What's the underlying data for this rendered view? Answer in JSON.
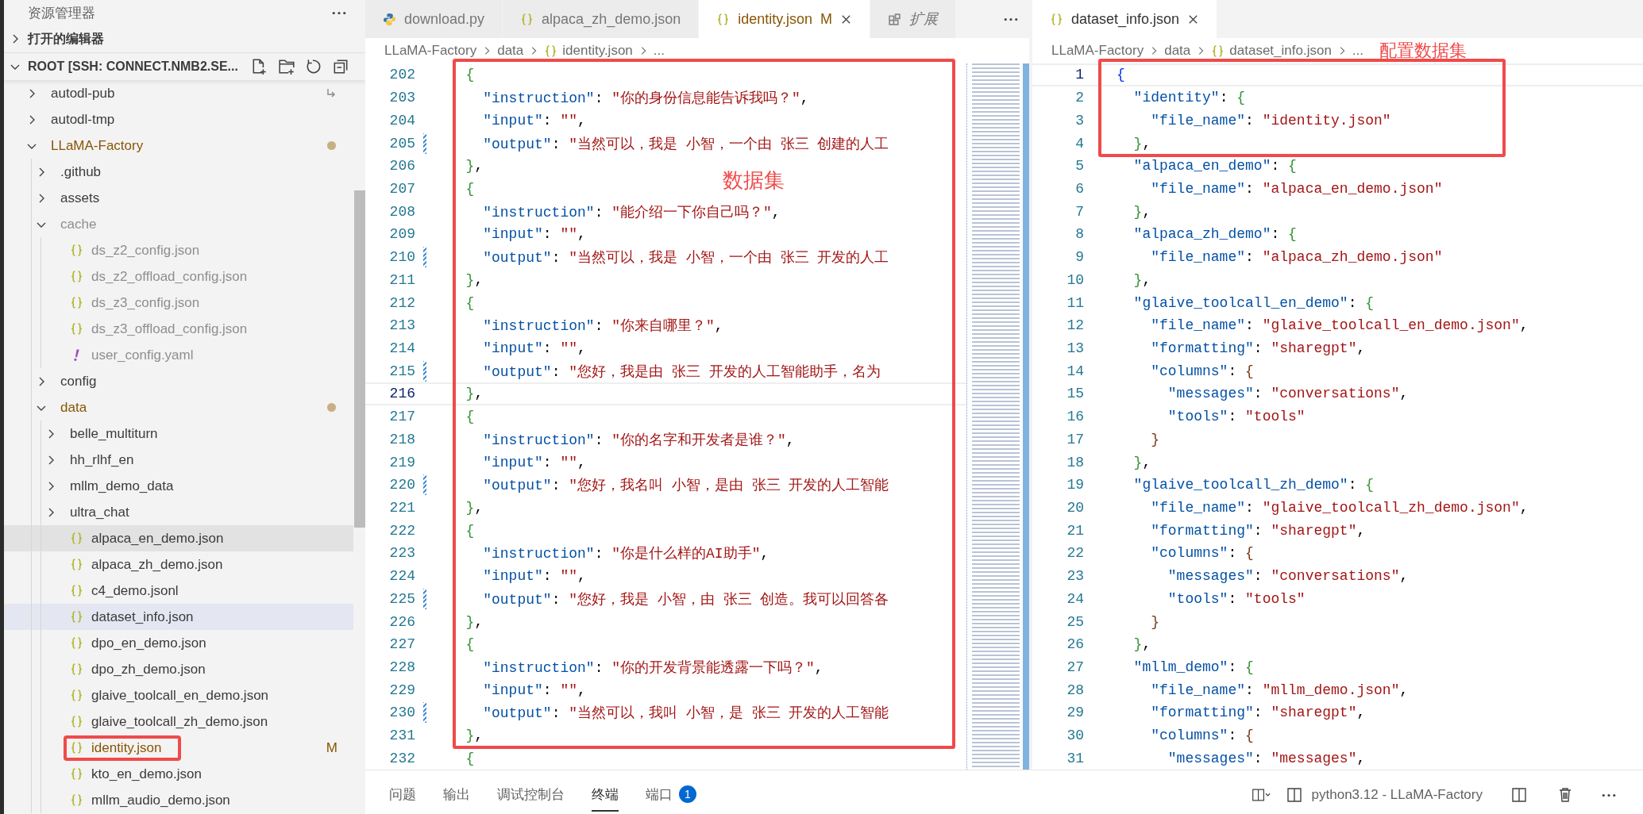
{
  "explorer": {
    "title": "资源管理器",
    "sections": [
      {
        "label": "打开的编辑器",
        "expanded": false
      },
      {
        "label": "ROOT [SSH: CONNECT.NMB2.SE...",
        "expanded": true
      }
    ],
    "tree": [
      {
        "name": "autodl-pub",
        "kind": "link",
        "expanded": false,
        "modified": false,
        "ignored": false,
        "selected": false,
        "hovered": false,
        "boxed": false
      },
      {
        "name": "autodl-tmp",
        "kind": "folder",
        "expanded": false,
        "modified": false,
        "ignored": false,
        "selected": false,
        "hovered": false,
        "boxed": false
      },
      {
        "name": "LLaMA-Factory",
        "kind": "folder",
        "expanded": true,
        "modified": true,
        "ignored": false,
        "selected": false,
        "hovered": false,
        "boxed": false,
        "children": [
          {
            "name": ".github",
            "kind": "folder",
            "expanded": false,
            "modified": false,
            "ignored": false,
            "selected": false,
            "hovered": false,
            "boxed": false
          },
          {
            "name": "assets",
            "kind": "folder",
            "expanded": false,
            "modified": false,
            "ignored": false,
            "selected": false,
            "hovered": false,
            "boxed": false
          },
          {
            "name": "cache",
            "kind": "folder",
            "expanded": true,
            "modified": false,
            "ignored": true,
            "selected": false,
            "hovered": false,
            "boxed": false,
            "children": [
              {
                "name": "ds_z2_config.json",
                "kind": "json",
                "modified": false,
                "ignored": true,
                "selected": false,
                "hovered": false,
                "boxed": false
              },
              {
                "name": "ds_z2_offload_config.json",
                "kind": "json",
                "modified": false,
                "ignored": true,
                "selected": false,
                "hovered": false,
                "boxed": false
              },
              {
                "name": "ds_z3_config.json",
                "kind": "json",
                "modified": false,
                "ignored": true,
                "selected": false,
                "hovered": false,
                "boxed": false
              },
              {
                "name": "ds_z3_offload_config.json",
                "kind": "json",
                "modified": false,
                "ignored": true,
                "selected": false,
                "hovered": false,
                "boxed": false
              },
              {
                "name": "user_config.yaml",
                "kind": "yaml",
                "modified": false,
                "ignored": true,
                "selected": false,
                "hovered": false,
                "boxed": false
              }
            ]
          },
          {
            "name": "config",
            "kind": "folder",
            "expanded": false,
            "modified": false,
            "ignored": false,
            "selected": false,
            "hovered": false,
            "boxed": false
          },
          {
            "name": "data",
            "kind": "folder",
            "expanded": true,
            "modified": true,
            "ignored": false,
            "selected": false,
            "hovered": false,
            "boxed": false,
            "children": [
              {
                "name": "belle_multiturn",
                "kind": "folder",
                "expanded": false,
                "modified": false,
                "ignored": false,
                "selected": false,
                "hovered": false,
                "boxed": false
              },
              {
                "name": "hh_rlhf_en",
                "kind": "folder",
                "expanded": false,
                "modified": false,
                "ignored": false,
                "selected": false,
                "hovered": false,
                "boxed": false
              },
              {
                "name": "mllm_demo_data",
                "kind": "folder",
                "expanded": false,
                "modified": false,
                "ignored": false,
                "selected": false,
                "hovered": false,
                "boxed": false
              },
              {
                "name": "ultra_chat",
                "kind": "folder",
                "expanded": false,
                "modified": false,
                "ignored": false,
                "selected": false,
                "hovered": false,
                "boxed": false
              },
              {
                "name": "alpaca_en_demo.json",
                "kind": "json",
                "modified": false,
                "ignored": false,
                "selected": false,
                "hovered": true,
                "boxed": false
              },
              {
                "name": "alpaca_zh_demo.json",
                "kind": "json",
                "modified": false,
                "ignored": false,
                "selected": false,
                "hovered": false,
                "boxed": false
              },
              {
                "name": "c4_demo.jsonl",
                "kind": "json",
                "modified": false,
                "ignored": false,
                "selected": false,
                "hovered": false,
                "boxed": false
              },
              {
                "name": "dataset_info.json",
                "kind": "json",
                "modified": false,
                "ignored": false,
                "selected": true,
                "hovered": false,
                "boxed": false
              },
              {
                "name": "dpo_en_demo.json",
                "kind": "json",
                "modified": false,
                "ignored": false,
                "selected": false,
                "hovered": false,
                "boxed": false
              },
              {
                "name": "dpo_zh_demo.json",
                "kind": "json",
                "modified": false,
                "ignored": false,
                "selected": false,
                "hovered": false,
                "boxed": false
              },
              {
                "name": "glaive_toolcall_en_demo.json",
                "kind": "json",
                "modified": false,
                "ignored": false,
                "selected": false,
                "hovered": false,
                "boxed": false
              },
              {
                "name": "glaive_toolcall_zh_demo.json",
                "kind": "json",
                "modified": false,
                "ignored": false,
                "selected": false,
                "hovered": false,
                "boxed": false
              },
              {
                "name": "identity.json",
                "kind": "json",
                "modified": true,
                "ignored": false,
                "badge": "M",
                "selected": false,
                "hovered": false,
                "boxed": true
              },
              {
                "name": "kto_en_demo.json",
                "kind": "json",
                "modified": false,
                "ignored": false,
                "selected": false,
                "hovered": false,
                "boxed": false
              },
              {
                "name": "mllm_audio_demo.json",
                "kind": "json",
                "modified": false,
                "ignored": false,
                "selected": false,
                "hovered": false,
                "boxed": false
              }
            ]
          }
        ]
      }
    ]
  },
  "left_editor": {
    "tabs": [
      {
        "label": "download.py",
        "kind": "python",
        "selected": false,
        "modified": false,
        "preview": false
      },
      {
        "label": "alpaca_zh_demo.json",
        "kind": "json",
        "selected": false,
        "modified": false,
        "preview": false
      },
      {
        "label": "identity.json",
        "kind": "json",
        "selected": true,
        "modified": true,
        "badge": "M",
        "preview": false
      },
      {
        "label": "扩展",
        "kind": "extension",
        "selected": false,
        "modified": false,
        "preview": true
      }
    ],
    "breadcrumb": [
      {
        "label": "LLaMA-Factory",
        "kind": "folder"
      },
      {
        "label": "data",
        "kind": "folder"
      },
      {
        "label": "identity.json",
        "kind": "json"
      },
      {
        "label": "...",
        "kind": "more"
      }
    ],
    "annotation": "数据集",
    "lines": [
      {
        "num": "202",
        "current": false,
        "modified": false,
        "tokens": [
          {
            "kind": "b2",
            "text": "  {"
          }
        ]
      },
      {
        "num": "203",
        "current": false,
        "modified": false,
        "tokens": [
          {
            "kind": "key",
            "text": "    \"instruction\""
          },
          {
            "kind": "p",
            "text": ": "
          },
          {
            "kind": "str",
            "text": "\"你的身份信息能告诉我吗？\""
          },
          {
            "kind": "p",
            "text": ","
          }
        ]
      },
      {
        "num": "204",
        "current": false,
        "modified": false,
        "tokens": [
          {
            "kind": "key",
            "text": "    \"input\""
          },
          {
            "kind": "p",
            "text": ": "
          },
          {
            "kind": "str",
            "text": "\"\""
          },
          {
            "kind": "p",
            "text": ","
          }
        ]
      },
      {
        "num": "205",
        "current": false,
        "modified": true,
        "tokens": [
          {
            "kind": "key",
            "text": "    \"output\""
          },
          {
            "kind": "p",
            "text": ": "
          },
          {
            "kind": "str",
            "text": "\"当然可以，我是 小智，一个由 张三 创建的人工"
          }
        ]
      },
      {
        "num": "206",
        "current": false,
        "modified": false,
        "tokens": [
          {
            "kind": "b2",
            "text": "  }"
          },
          {
            "kind": "p",
            "text": ","
          }
        ]
      },
      {
        "num": "207",
        "current": false,
        "modified": false,
        "tokens": [
          {
            "kind": "b2",
            "text": "  {"
          }
        ]
      },
      {
        "num": "208",
        "current": false,
        "modified": false,
        "tokens": [
          {
            "kind": "key",
            "text": "    \"instruction\""
          },
          {
            "kind": "p",
            "text": ": "
          },
          {
            "kind": "str",
            "text": "\"能介绍一下你自己吗？\""
          },
          {
            "kind": "p",
            "text": ","
          }
        ]
      },
      {
        "num": "209",
        "current": false,
        "modified": false,
        "tokens": [
          {
            "kind": "key",
            "text": "    \"input\""
          },
          {
            "kind": "p",
            "text": ": "
          },
          {
            "kind": "str",
            "text": "\"\""
          },
          {
            "kind": "p",
            "text": ","
          }
        ]
      },
      {
        "num": "210",
        "current": false,
        "modified": true,
        "tokens": [
          {
            "kind": "key",
            "text": "    \"output\""
          },
          {
            "kind": "p",
            "text": ": "
          },
          {
            "kind": "str",
            "text": "\"当然可以，我是 小智，一个由 张三 开发的人工"
          }
        ]
      },
      {
        "num": "211",
        "current": false,
        "modified": false,
        "tokens": [
          {
            "kind": "b2",
            "text": "  }"
          },
          {
            "kind": "p",
            "text": ","
          }
        ]
      },
      {
        "num": "212",
        "current": false,
        "modified": false,
        "tokens": [
          {
            "kind": "b2",
            "text": "  {"
          }
        ]
      },
      {
        "num": "213",
        "current": false,
        "modified": false,
        "tokens": [
          {
            "kind": "key",
            "text": "    \"instruction\""
          },
          {
            "kind": "p",
            "text": ": "
          },
          {
            "kind": "str",
            "text": "\"你来自哪里？\""
          },
          {
            "kind": "p",
            "text": ","
          }
        ]
      },
      {
        "num": "214",
        "current": false,
        "modified": false,
        "tokens": [
          {
            "kind": "key",
            "text": "    \"input\""
          },
          {
            "kind": "p",
            "text": ": "
          },
          {
            "kind": "str",
            "text": "\"\""
          },
          {
            "kind": "p",
            "text": ","
          }
        ]
      },
      {
        "num": "215",
        "current": false,
        "modified": true,
        "tokens": [
          {
            "kind": "key",
            "text": "    \"output\""
          },
          {
            "kind": "p",
            "text": ": "
          },
          {
            "kind": "str",
            "text": "\"您好，我是由 张三 开发的人工智能助手，名为"
          }
        ]
      },
      {
        "num": "216",
        "current": true,
        "modified": false,
        "tokens": [
          {
            "kind": "b2",
            "text": "  }"
          },
          {
            "kind": "p",
            "text": ","
          }
        ]
      },
      {
        "num": "217",
        "current": false,
        "modified": false,
        "tokens": [
          {
            "kind": "b2",
            "text": "  {"
          }
        ]
      },
      {
        "num": "218",
        "current": false,
        "modified": false,
        "tokens": [
          {
            "kind": "key",
            "text": "    \"instruction\""
          },
          {
            "kind": "p",
            "text": ": "
          },
          {
            "kind": "str",
            "text": "\"你的名字和开发者是谁？\""
          },
          {
            "kind": "p",
            "text": ","
          }
        ]
      },
      {
        "num": "219",
        "current": false,
        "modified": false,
        "tokens": [
          {
            "kind": "key",
            "text": "    \"input\""
          },
          {
            "kind": "p",
            "text": ": "
          },
          {
            "kind": "str",
            "text": "\"\""
          },
          {
            "kind": "p",
            "text": ","
          }
        ]
      },
      {
        "num": "220",
        "current": false,
        "modified": true,
        "tokens": [
          {
            "kind": "key",
            "text": "    \"output\""
          },
          {
            "kind": "p",
            "text": ": "
          },
          {
            "kind": "str",
            "text": "\"您好，我名叫 小智，是由 张三 开发的人工智能"
          }
        ]
      },
      {
        "num": "221",
        "current": false,
        "modified": false,
        "tokens": [
          {
            "kind": "b2",
            "text": "  }"
          },
          {
            "kind": "p",
            "text": ","
          }
        ]
      },
      {
        "num": "222",
        "current": false,
        "modified": false,
        "tokens": [
          {
            "kind": "b2",
            "text": "  {"
          }
        ]
      },
      {
        "num": "223",
        "current": false,
        "modified": false,
        "tokens": [
          {
            "kind": "key",
            "text": "    \"instruction\""
          },
          {
            "kind": "p",
            "text": ": "
          },
          {
            "kind": "str",
            "text": "\"你是什么样的AI助手\""
          },
          {
            "kind": "p",
            "text": ","
          }
        ]
      },
      {
        "num": "224",
        "current": false,
        "modified": false,
        "tokens": [
          {
            "kind": "key",
            "text": "    \"input\""
          },
          {
            "kind": "p",
            "text": ": "
          },
          {
            "kind": "str",
            "text": "\"\""
          },
          {
            "kind": "p",
            "text": ","
          }
        ]
      },
      {
        "num": "225",
        "current": false,
        "modified": true,
        "tokens": [
          {
            "kind": "key",
            "text": "    \"output\""
          },
          {
            "kind": "p",
            "text": ": "
          },
          {
            "kind": "str",
            "text": "\"您好，我是 小智，由 张三 创造。我可以回答各"
          }
        ]
      },
      {
        "num": "226",
        "current": false,
        "modified": false,
        "tokens": [
          {
            "kind": "b2",
            "text": "  }"
          },
          {
            "kind": "p",
            "text": ","
          }
        ]
      },
      {
        "num": "227",
        "current": false,
        "modified": false,
        "tokens": [
          {
            "kind": "b2",
            "text": "  {"
          }
        ]
      },
      {
        "num": "228",
        "current": false,
        "modified": false,
        "tokens": [
          {
            "kind": "key",
            "text": "    \"instruction\""
          },
          {
            "kind": "p",
            "text": ": "
          },
          {
            "kind": "str",
            "text": "\"你的开发背景能透露一下吗？\""
          },
          {
            "kind": "p",
            "text": ","
          }
        ]
      },
      {
        "num": "229",
        "current": false,
        "modified": false,
        "tokens": [
          {
            "kind": "key",
            "text": "    \"input\""
          },
          {
            "kind": "p",
            "text": ": "
          },
          {
            "kind": "str",
            "text": "\"\""
          },
          {
            "kind": "p",
            "text": ","
          }
        ]
      },
      {
        "num": "230",
        "current": false,
        "modified": true,
        "tokens": [
          {
            "kind": "key",
            "text": "    \"output\""
          },
          {
            "kind": "p",
            "text": ": "
          },
          {
            "kind": "str",
            "text": "\"当然可以，我叫 小智，是 张三 开发的人工智能"
          }
        ]
      },
      {
        "num": "231",
        "current": false,
        "modified": false,
        "tokens": [
          {
            "kind": "b2",
            "text": "  }"
          },
          {
            "kind": "p",
            "text": ","
          }
        ]
      },
      {
        "num": "232",
        "current": false,
        "modified": false,
        "tokens": [
          {
            "kind": "b2",
            "text": "  {"
          }
        ]
      }
    ]
  },
  "right_editor": {
    "tabs": [
      {
        "label": "dataset_info.json",
        "kind": "json",
        "selected": true,
        "modified": false,
        "preview": false
      }
    ],
    "breadcrumb": [
      {
        "label": "LLaMA-Factory",
        "kind": "folder"
      },
      {
        "label": "data",
        "kind": "folder"
      },
      {
        "label": "dataset_info.json",
        "kind": "json"
      },
      {
        "label": "...",
        "kind": "more"
      }
    ],
    "annotation": "配置数据集",
    "lines": [
      {
        "num": "1",
        "current": true,
        "tokens": [
          {
            "kind": "b1",
            "text": "{"
          }
        ]
      },
      {
        "num": "2",
        "current": false,
        "tokens": [
          {
            "kind": "key",
            "text": "  \"identity\""
          },
          {
            "kind": "p",
            "text": ": "
          },
          {
            "kind": "b2",
            "text": "{"
          }
        ]
      },
      {
        "num": "3",
        "current": false,
        "tokens": [
          {
            "kind": "key",
            "text": "    \"file_name\""
          },
          {
            "kind": "p",
            "text": ": "
          },
          {
            "kind": "str",
            "text": "\"identity.json\""
          }
        ]
      },
      {
        "num": "4",
        "current": false,
        "tokens": [
          {
            "kind": "b2",
            "text": "  }"
          },
          {
            "kind": "p",
            "text": ","
          }
        ]
      },
      {
        "num": "5",
        "current": false,
        "tokens": [
          {
            "kind": "key",
            "text": "  \"alpaca_en_demo\""
          },
          {
            "kind": "p",
            "text": ": "
          },
          {
            "kind": "b2",
            "text": "{"
          }
        ]
      },
      {
        "num": "6",
        "current": false,
        "tokens": [
          {
            "kind": "key",
            "text": "    \"file_name\""
          },
          {
            "kind": "p",
            "text": ": "
          },
          {
            "kind": "str",
            "text": "\"alpaca_en_demo.json\""
          }
        ]
      },
      {
        "num": "7",
        "current": false,
        "tokens": [
          {
            "kind": "b2",
            "text": "  }"
          },
          {
            "kind": "p",
            "text": ","
          }
        ]
      },
      {
        "num": "8",
        "current": false,
        "tokens": [
          {
            "kind": "key",
            "text": "  \"alpaca_zh_demo\""
          },
          {
            "kind": "p",
            "text": ": "
          },
          {
            "kind": "b2",
            "text": "{"
          }
        ]
      },
      {
        "num": "9",
        "current": false,
        "tokens": [
          {
            "kind": "key",
            "text": "    \"file_name\""
          },
          {
            "kind": "p",
            "text": ": "
          },
          {
            "kind": "str",
            "text": "\"alpaca_zh_demo.json\""
          }
        ]
      },
      {
        "num": "10",
        "current": false,
        "tokens": [
          {
            "kind": "b2",
            "text": "  }"
          },
          {
            "kind": "p",
            "text": ","
          }
        ]
      },
      {
        "num": "11",
        "current": false,
        "tokens": [
          {
            "kind": "key",
            "text": "  \"glaive_toolcall_en_demo\""
          },
          {
            "kind": "p",
            "text": ": "
          },
          {
            "kind": "b2",
            "text": "{"
          }
        ]
      },
      {
        "num": "12",
        "current": false,
        "tokens": [
          {
            "kind": "key",
            "text": "    \"file_name\""
          },
          {
            "kind": "p",
            "text": ": "
          },
          {
            "kind": "str",
            "text": "\"glaive_toolcall_en_demo.json\""
          },
          {
            "kind": "p",
            "text": ","
          }
        ]
      },
      {
        "num": "13",
        "current": false,
        "tokens": [
          {
            "kind": "key",
            "text": "    \"formatting\""
          },
          {
            "kind": "p",
            "text": ": "
          },
          {
            "kind": "str",
            "text": "\"sharegpt\""
          },
          {
            "kind": "p",
            "text": ","
          }
        ]
      },
      {
        "num": "14",
        "current": false,
        "tokens": [
          {
            "kind": "key",
            "text": "    \"columns\""
          },
          {
            "kind": "p",
            "text": ": "
          },
          {
            "kind": "b3",
            "text": "{"
          }
        ]
      },
      {
        "num": "15",
        "current": false,
        "tokens": [
          {
            "kind": "key",
            "text": "      \"messages\""
          },
          {
            "kind": "p",
            "text": ": "
          },
          {
            "kind": "str",
            "text": "\"conversations\""
          },
          {
            "kind": "p",
            "text": ","
          }
        ]
      },
      {
        "num": "16",
        "current": false,
        "tokens": [
          {
            "kind": "key",
            "text": "      \"tools\""
          },
          {
            "kind": "p",
            "text": ": "
          },
          {
            "kind": "str",
            "text": "\"tools\""
          }
        ]
      },
      {
        "num": "17",
        "current": false,
        "tokens": [
          {
            "kind": "b3",
            "text": "    }"
          }
        ]
      },
      {
        "num": "18",
        "current": false,
        "tokens": [
          {
            "kind": "b2",
            "text": "  }"
          },
          {
            "kind": "p",
            "text": ","
          }
        ]
      },
      {
        "num": "19",
        "current": false,
        "tokens": [
          {
            "kind": "key",
            "text": "  \"glaive_toolcall_zh_demo\""
          },
          {
            "kind": "p",
            "text": ": "
          },
          {
            "kind": "b2",
            "text": "{"
          }
        ]
      },
      {
        "num": "20",
        "current": false,
        "tokens": [
          {
            "kind": "key",
            "text": "    \"file_name\""
          },
          {
            "kind": "p",
            "text": ": "
          },
          {
            "kind": "str",
            "text": "\"glaive_toolcall_zh_demo.json\""
          },
          {
            "kind": "p",
            "text": ","
          }
        ]
      },
      {
        "num": "21",
        "current": false,
        "tokens": [
          {
            "kind": "key",
            "text": "    \"formatting\""
          },
          {
            "kind": "p",
            "text": ": "
          },
          {
            "kind": "str",
            "text": "\"sharegpt\""
          },
          {
            "kind": "p",
            "text": ","
          }
        ]
      },
      {
        "num": "22",
        "current": false,
        "tokens": [
          {
            "kind": "key",
            "text": "    \"columns\""
          },
          {
            "kind": "p",
            "text": ": "
          },
          {
            "kind": "b3",
            "text": "{"
          }
        ]
      },
      {
        "num": "23",
        "current": false,
        "tokens": [
          {
            "kind": "key",
            "text": "      \"messages\""
          },
          {
            "kind": "p",
            "text": ": "
          },
          {
            "kind": "str",
            "text": "\"conversations\""
          },
          {
            "kind": "p",
            "text": ","
          }
        ]
      },
      {
        "num": "24",
        "current": false,
        "tokens": [
          {
            "kind": "key",
            "text": "      \"tools\""
          },
          {
            "kind": "p",
            "text": ": "
          },
          {
            "kind": "str",
            "text": "\"tools\""
          }
        ]
      },
      {
        "num": "25",
        "current": false,
        "tokens": [
          {
            "kind": "b3",
            "text": "    }"
          }
        ]
      },
      {
        "num": "26",
        "current": false,
        "tokens": [
          {
            "kind": "b2",
            "text": "  }"
          },
          {
            "kind": "p",
            "text": ","
          }
        ]
      },
      {
        "num": "27",
        "current": false,
        "tokens": [
          {
            "kind": "key",
            "text": "  \"mllm_demo\""
          },
          {
            "kind": "p",
            "text": ": "
          },
          {
            "kind": "b2",
            "text": "{"
          }
        ]
      },
      {
        "num": "28",
        "current": false,
        "tokens": [
          {
            "kind": "key",
            "text": "    \"file_name\""
          },
          {
            "kind": "p",
            "text": ": "
          },
          {
            "kind": "str",
            "text": "\"mllm_demo.json\""
          },
          {
            "kind": "p",
            "text": ","
          }
        ]
      },
      {
        "num": "29",
        "current": false,
        "tokens": [
          {
            "kind": "key",
            "text": "    \"formatting\""
          },
          {
            "kind": "p",
            "text": ": "
          },
          {
            "kind": "str",
            "text": "\"sharegpt\""
          },
          {
            "kind": "p",
            "text": ","
          }
        ]
      },
      {
        "num": "30",
        "current": false,
        "tokens": [
          {
            "kind": "key",
            "text": "    \"columns\""
          },
          {
            "kind": "p",
            "text": ": "
          },
          {
            "kind": "b3",
            "text": "{"
          }
        ]
      },
      {
        "num": "31",
        "current": false,
        "tokens": [
          {
            "kind": "key",
            "text": "      \"messages\""
          },
          {
            "kind": "p",
            "text": ": "
          },
          {
            "kind": "str",
            "text": "\"messages\""
          },
          {
            "kind": "p",
            "text": ","
          }
        ]
      }
    ]
  },
  "panel": {
    "tabs": [
      {
        "label": "问题",
        "selected": false
      },
      {
        "label": "输出",
        "selected": false
      },
      {
        "label": "调试控制台",
        "selected": false
      },
      {
        "label": "终端",
        "selected": true
      },
      {
        "label": "端口",
        "selected": false,
        "badge": "1"
      }
    ],
    "terminal": "python3.12 - LLaMA-Factory"
  }
}
